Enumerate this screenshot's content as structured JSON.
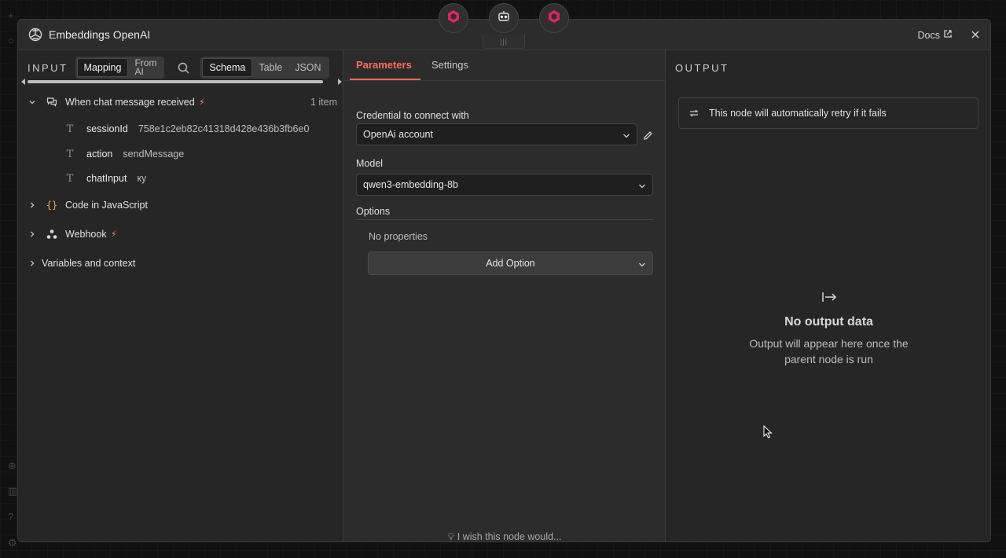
{
  "modal": {
    "title": "Embeddings OpenAI",
    "app_icon": "openai-icon",
    "docs_label": "Docs",
    "close_icon": "close-icon"
  },
  "top_nodes": [
    "cube-icon",
    "robot-icon",
    "cube-icon"
  ],
  "input": {
    "label": "INPUT",
    "mode_tabs": [
      {
        "label": "Mapping",
        "active": true
      },
      {
        "label": "From",
        "label2": "AI",
        "active": false
      }
    ],
    "view_tabs": [
      {
        "label": "Schema",
        "active": true
      },
      {
        "label": "Table",
        "active": false
      },
      {
        "label": "JSON",
        "active": false
      }
    ],
    "nodes": [
      {
        "label": "When chat message received",
        "icon": "chat-icon",
        "expanded": true,
        "trigger": true,
        "count": "1 item",
        "fields": [
          {
            "key": "sessionId",
            "value": "758e1c2eb82c41318d428e436b3fb6e0",
            "type_icon": "text-type-icon"
          },
          {
            "key": "action",
            "value": "sendMessage",
            "type_icon": "text-type-icon"
          },
          {
            "key": "chatInput",
            "value": "ку",
            "type_icon": "text-type-icon"
          }
        ]
      },
      {
        "label": "Code in JavaScript",
        "icon": "code-braces-icon",
        "expanded": false,
        "trigger": false
      },
      {
        "label": "Webhook",
        "icon": "webhook-icon",
        "expanded": false,
        "trigger": true
      }
    ],
    "variables_label": "Variables and context"
  },
  "params": {
    "tabs": [
      {
        "label": "Parameters",
        "active": true
      },
      {
        "label": "Settings",
        "active": false
      }
    ],
    "credential_label": "Credential to connect with",
    "credential_value": "OpenAi account",
    "model_label": "Model",
    "model_value": "qwen3-embedding-8b",
    "options_label": "Options",
    "no_properties": "No properties",
    "add_option": "Add Option",
    "wish": "I wish this node would..."
  },
  "output": {
    "label": "OUTPUT",
    "retry_notice": "This node will automatically retry if it fails",
    "empty_title": "No output data",
    "empty_text_1": "Output will appear here once the",
    "empty_text_2": "parent node is run"
  },
  "colors": {
    "accent": "#ff6d5a",
    "node_pink": "#e0245e",
    "panel_bg": "#2a2a2a"
  }
}
